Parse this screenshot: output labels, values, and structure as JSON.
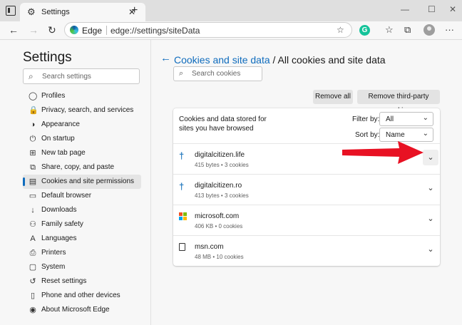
{
  "tab": {
    "title": "Settings"
  },
  "toolbar": {
    "browser_name": "Edge",
    "url": "edge://settings/siteData",
    "grammarly_letter": "G"
  },
  "sidebar": {
    "title": "Settings",
    "search_placeholder": "Search settings",
    "items": [
      {
        "label": "Profiles",
        "icon": "profile-icon",
        "glyph": "◯"
      },
      {
        "label": "Privacy, search, and services",
        "icon": "lock-icon",
        "glyph": "🔒"
      },
      {
        "label": "Appearance",
        "icon": "appearance-icon",
        "glyph": "◑"
      },
      {
        "label": "On startup",
        "icon": "power-icon",
        "glyph": "⏻"
      },
      {
        "label": "New tab page",
        "icon": "new-tab-icon",
        "glyph": "⊞"
      },
      {
        "label": "Share, copy, and paste",
        "icon": "share-icon",
        "glyph": "⧉"
      },
      {
        "label": "Cookies and site permissions",
        "icon": "site-permissions-icon",
        "glyph": "▤",
        "active": true
      },
      {
        "label": "Default browser",
        "icon": "default-browser-icon",
        "glyph": "▭"
      },
      {
        "label": "Downloads",
        "icon": "download-icon",
        "glyph": "↓"
      },
      {
        "label": "Family safety",
        "icon": "family-icon",
        "glyph": "⚇"
      },
      {
        "label": "Languages",
        "icon": "languages-icon",
        "glyph": "A"
      },
      {
        "label": "Printers",
        "icon": "printer-icon",
        "glyph": "⎙"
      },
      {
        "label": "System",
        "icon": "system-icon",
        "glyph": "▢"
      },
      {
        "label": "Reset settings",
        "icon": "reset-icon",
        "glyph": "↺"
      },
      {
        "label": "Phone and other devices",
        "icon": "phone-icon",
        "glyph": "▯"
      },
      {
        "label": "About Microsoft Edge",
        "icon": "edge-icon",
        "glyph": "◉"
      }
    ]
  },
  "main": {
    "breadcrumb_link": "Cookies and site data",
    "breadcrumb_sep": " / ",
    "breadcrumb_current": "All cookies and site data",
    "search_placeholder": "Search cookies",
    "remove_all": "Remove all",
    "remove_third_party": "Remove third-party cookies",
    "card_description": "Cookies and data stored for sites you have browsed",
    "filter_label": "Filter by:",
    "filter_value": "All",
    "sort_label": "Sort by:",
    "sort_value": "Name",
    "sites": [
      {
        "name": "digitalcitizen.life",
        "meta": "415 bytes • 3 cookies",
        "icon": "digitalcitizen-icon"
      },
      {
        "name": "digitalcitizen.ro",
        "meta": "413 bytes • 3 cookies",
        "icon": "digitalcitizen-icon"
      },
      {
        "name": "microsoft.com",
        "meta": "406 KB • 0 cookies",
        "icon": "microsoft-logo-icon"
      },
      {
        "name": "msn.com",
        "meta": "48 MB • 10 cookies",
        "icon": "file-icon"
      }
    ]
  },
  "colors": {
    "accent": "#0f6cbd",
    "annotation_arrow": "#e81123",
    "ms_red": "#f25022",
    "ms_green": "#7fba00",
    "ms_blue": "#00a4ef",
    "ms_yellow": "#ffb900"
  }
}
